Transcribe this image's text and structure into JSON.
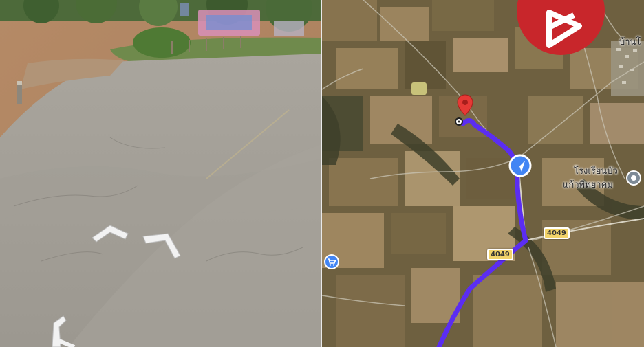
{
  "map": {
    "labels": {
      "village": "บ้านโ",
      "school_line1": "โรงเรียนบัว",
      "school_line2": "แก้วพิทยาคม"
    },
    "road_shields": [
      "4049",
      "4049"
    ],
    "icons": {
      "destination": "map-pin-icon",
      "current_location": "navigation-arrow-icon",
      "origin": "origin-dot-icon",
      "school": "place-marker-icon",
      "shop": "shopping-cart-icon",
      "watermark": "brand-logo-icon"
    },
    "colors": {
      "route": "#5b2df2",
      "pin": "#e53935",
      "nav": "#4285f4",
      "logo": "#c8262b"
    }
  },
  "street_view": {
    "controls": [
      "move-forward-left",
      "move-forward-right",
      "move-back"
    ]
  }
}
